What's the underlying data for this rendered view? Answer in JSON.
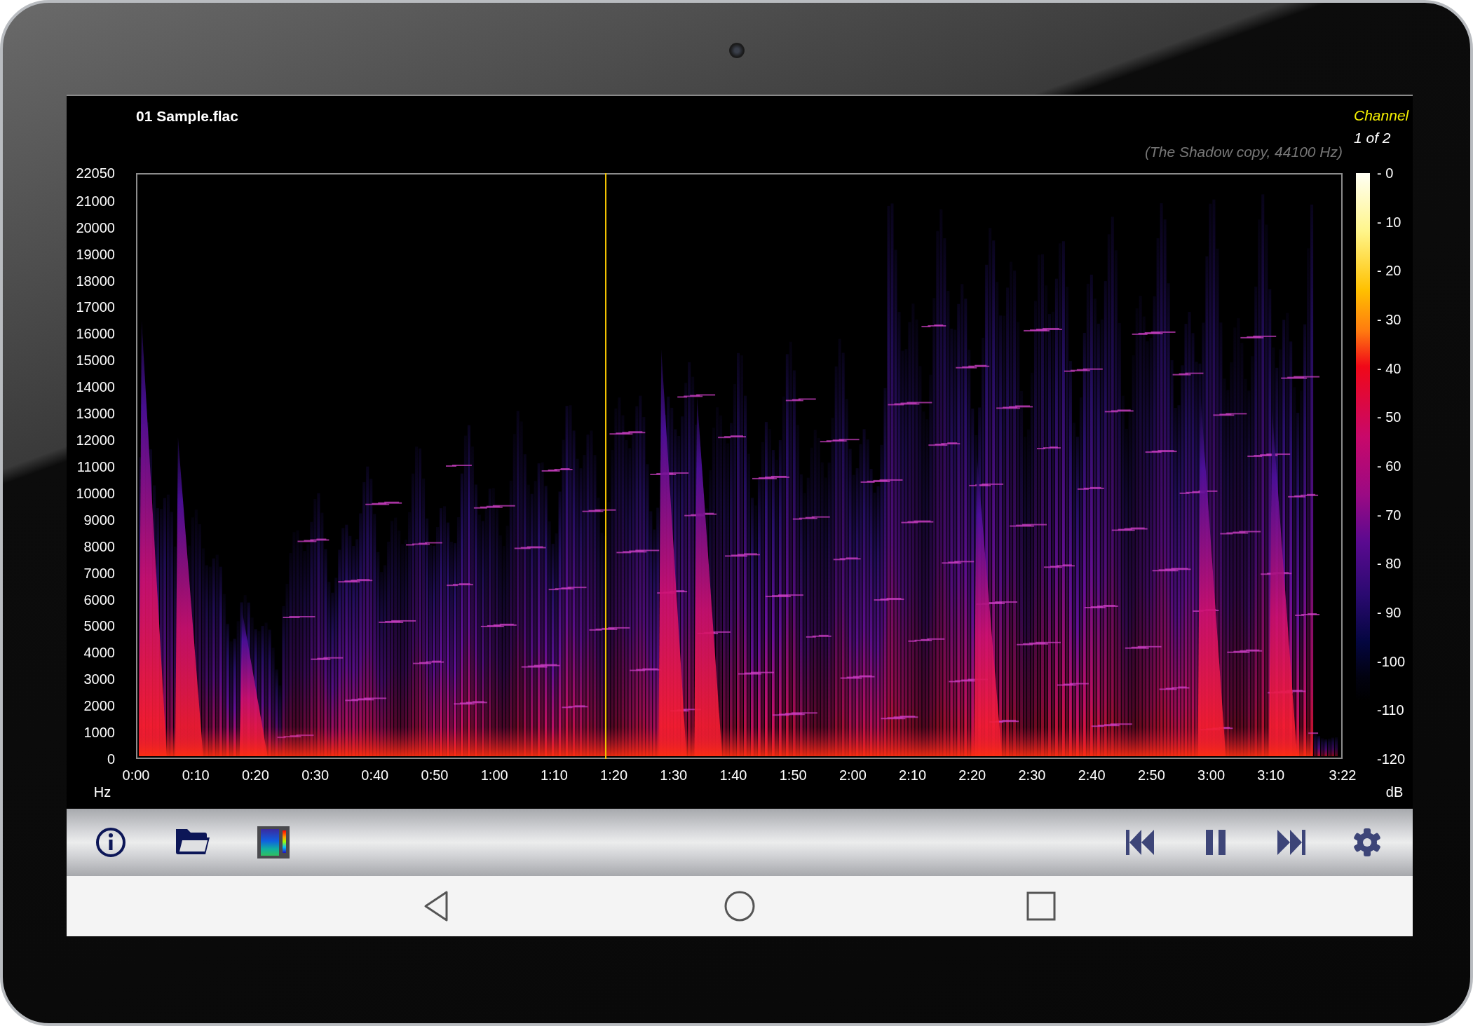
{
  "header": {
    "file_name": "01 Sample.flac",
    "channel_label": "Channel",
    "channel_value": "1 of 2",
    "source": "(The Shadow copy, 44100 Hz)"
  },
  "spectrogram": {
    "y_ticks": [
      "22050",
      "21000",
      "20000",
      "19000",
      "18000",
      "17000",
      "16000",
      "15000",
      "14000",
      "13000",
      "12000",
      "11000",
      "10000",
      "9000",
      "8000",
      "7000",
      "6000",
      "5000",
      "4000",
      "3000",
      "2000",
      "1000",
      "0"
    ],
    "y_unit": "Hz",
    "x_ticks": [
      "0:00",
      "0:10",
      "0:20",
      "0:30",
      "0:40",
      "0:50",
      "1:00",
      "1:10",
      "1:20",
      "1:30",
      "1:40",
      "1:50",
      "2:00",
      "2:10",
      "2:20",
      "2:30",
      "2:40",
      "2:50",
      "3:00",
      "3:10",
      "3:22"
    ],
    "cursor": {
      "level": 0.389
    },
    "db_ticks": [
      "- 0",
      "- 10",
      "- 20",
      "- 30",
      "- 40",
      "- 50",
      "- 60",
      "- 70",
      "- 80",
      "- 90",
      "-100",
      "-110",
      "-120"
    ],
    "db_unit": "dB"
  },
  "toolbar": {
    "left": [
      {
        "kind": "info"
      },
      {
        "kind": "open"
      },
      {
        "kind": "palette"
      }
    ],
    "right": [
      {
        "kind": "previous"
      },
      {
        "kind": "pause"
      },
      {
        "kind": "next"
      },
      {
        "kind": "settings"
      }
    ]
  },
  "navigation": [
    {
      "kind": "back"
    },
    {
      "kind": "home"
    },
    {
      "kind": "recents"
    }
  ]
}
